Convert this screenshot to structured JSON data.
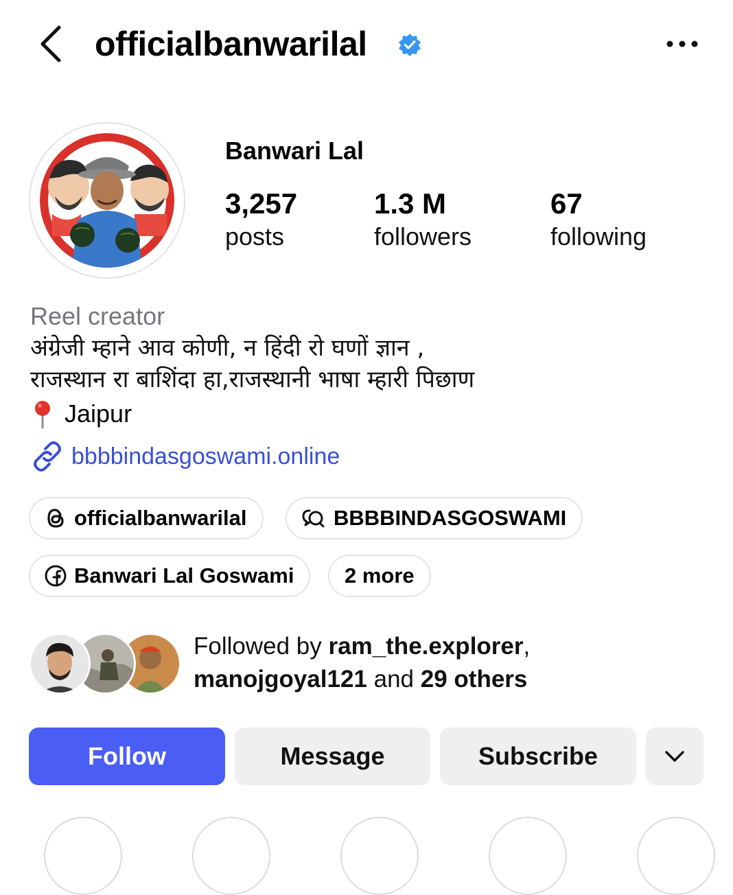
{
  "header": {
    "handle": "officialbanwarilal",
    "back_icon": "chevron-left-icon",
    "verified_icon": "verified-badge-icon",
    "more_icon": "more-horizontal-icon",
    "verified_color": "#3897f0"
  },
  "profile": {
    "display_name": "Banwari Lal",
    "stats": [
      {
        "value": "3,257",
        "label": "posts"
      },
      {
        "value": "1.3 M",
        "label": "followers"
      },
      {
        "value": "67",
        "label": "following"
      }
    ],
    "category": "Reel creator",
    "bio_lines": [
      "अंग्रेजी म्हाने आव कोणी, न हिंदी रो घणों ज्ञान ,",
      "राजस्थान रा बाशिंदा हा,राजस्थानी भाषा म्हारी पिछाण"
    ],
    "location_icon": "pin-icon",
    "location": "Jaipur",
    "link_icon": "link-icon",
    "link": "bbbbindasgoswami.online",
    "link_color": "#3a4fd6"
  },
  "chips": [
    {
      "icon": "threads-icon",
      "label": "officialbanwarilal"
    },
    {
      "icon": "channel-icon",
      "label": "BBBBINDASGOSWAMI"
    },
    {
      "icon": "facebook-icon",
      "label": "Banwari Lal Goswami"
    },
    {
      "icon": "",
      "label": "2 more"
    }
  ],
  "mutual": {
    "prefix": "Followed by ",
    "user1": "ram_the.explorer",
    "sep": ",",
    "user2": "manojgoyal121",
    "and": " and ",
    "others": "29 others"
  },
  "actions": {
    "follow": "Follow",
    "message": "Message",
    "subscribe": "Subscribe",
    "dropdown_icon": "chevron-down-icon",
    "follow_color": "#4a5df5"
  }
}
